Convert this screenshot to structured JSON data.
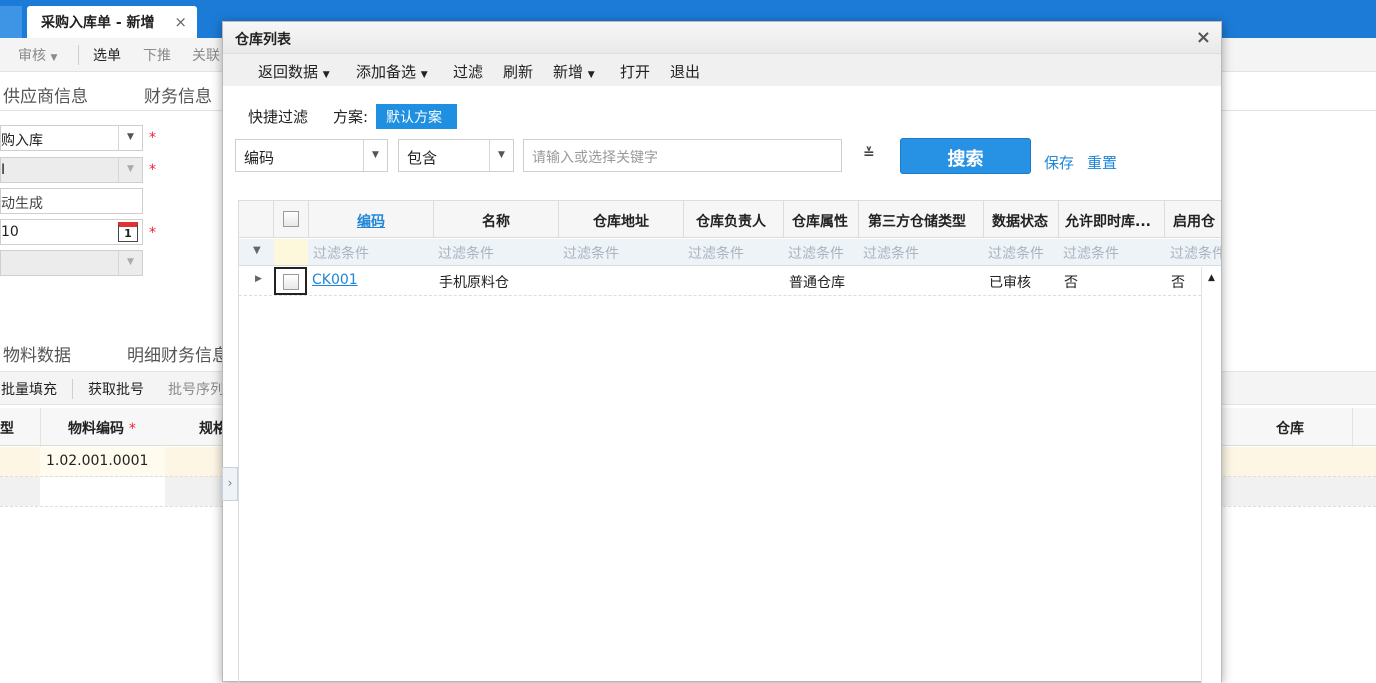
{
  "background": {
    "tab_title": "采购入库单 - 新增",
    "tab_close": "×",
    "toolbar": {
      "audit": "审核",
      "select_bill": "选单",
      "push_down": "下推",
      "link": "关联"
    },
    "sections": {
      "supplier": "供应商信息",
      "finance": "财务信息"
    },
    "fields": {
      "bill_type": "购入库",
      "field2": "I",
      "bill_no": "动生成",
      "date": "10",
      "calendar_day": "1",
      "required_mark": "*"
    },
    "detail_tabs": {
      "material": "物料数据",
      "detail_finance": "明细财务信息"
    },
    "detail_toolbar": {
      "batch_fill": "批量填充",
      "get_lot": "获取批号",
      "lot_serial": "批号序列"
    },
    "grid_headers": {
      "type": "型",
      "material_code": "物料编码",
      "spec": "规格",
      "warehouse": "仓库"
    },
    "row_material_code": "1.02.001.0001"
  },
  "modal": {
    "title": "仓库列表",
    "close": "×",
    "toolbar": {
      "return_data": "返回数据",
      "add_alternate": "添加备选",
      "filter": "过滤",
      "refresh": "刷新",
      "new": "新增",
      "open": "打开",
      "exit": "退出"
    },
    "quick_filter": "快捷过滤",
    "scheme_label": "方案:",
    "scheme_value": "默认方案",
    "filter_field": "编码",
    "filter_operator": "包含",
    "keyword_placeholder": "请输入或选择关键字",
    "search_button": "搜索",
    "save_link": "保存",
    "reset_link": "重置",
    "columns": {
      "code": "编码",
      "name": "名称",
      "address": "仓库地址",
      "manager": "仓库负责人",
      "attribute": "仓库属性",
      "third_party_type": "第三方仓储类型",
      "data_status": "数据状态",
      "allow_instant": "允许即时库...",
      "enable": "启用仓"
    },
    "filter_placeholder": "过滤条件",
    "rows": [
      {
        "code": "CK001",
        "name": "手机原料仓",
        "address": "",
        "manager": "",
        "attribute": "普通仓库",
        "third_party_type": "",
        "data_status": "已审核",
        "allow_instant": "否",
        "enable": "否"
      }
    ]
  }
}
